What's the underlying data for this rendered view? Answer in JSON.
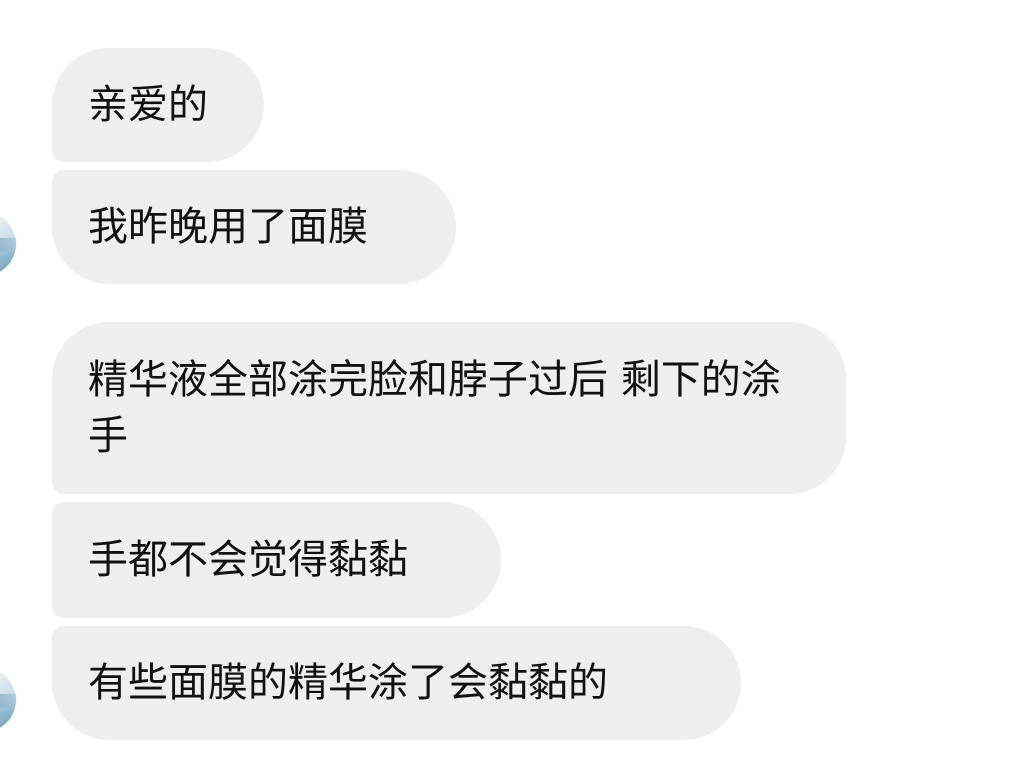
{
  "messages": [
    {
      "text": "亲爱的"
    },
    {
      "text": "我昨晚用了面膜"
    },
    {
      "text": "精华液全部涂完脸和脖子过后 剩下的涂手"
    },
    {
      "text": "手都不会觉得黏黏"
    },
    {
      "text": "有些面膜的精华涂了会黏黏的"
    }
  ],
  "colors": {
    "bubble": "#efefef",
    "text": "#111111",
    "background": "#ffffff"
  }
}
